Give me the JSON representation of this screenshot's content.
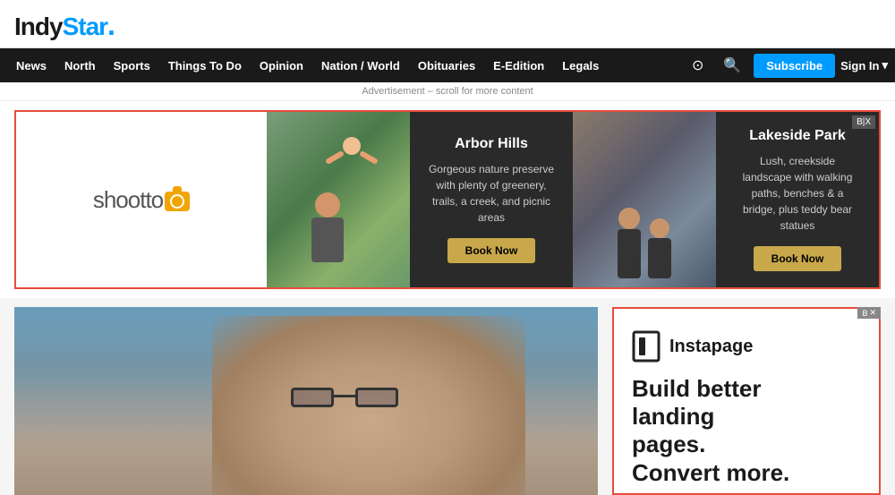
{
  "site": {
    "logo_text": "IndyStar",
    "logo_dot": "."
  },
  "nav": {
    "items": [
      {
        "label": "News",
        "id": "news"
      },
      {
        "label": "North",
        "id": "north"
      },
      {
        "label": "Sports",
        "id": "sports"
      },
      {
        "label": "Things To Do",
        "id": "things-to-do"
      },
      {
        "label": "Opinion",
        "id": "opinion"
      },
      {
        "label": "Nation / World",
        "id": "nation-world"
      },
      {
        "label": "Obituaries",
        "id": "obituaries"
      },
      {
        "label": "E-Edition",
        "id": "e-edition"
      },
      {
        "label": "Legals",
        "id": "legals"
      }
    ],
    "more_icon": "⊙",
    "search_icon": "🔍",
    "subscribe_label": "Subscribe",
    "signin_label": "Sign In",
    "signin_chevron": "▾"
  },
  "ad_notice": "Advertisement – scroll for more content",
  "main_ad": {
    "close_label": "B|X",
    "brand_name": "shootto",
    "left_section": {
      "title": "Arbor Hills",
      "description": "Gorgeous nature preserve with plenty of greenery, trails, a creek, and picnic areas",
      "cta": "Book Now"
    },
    "right_section": {
      "title": "Lakeside Park",
      "description": "Lush, creekside landscape with walking paths, benches & a bridge, plus teddy bear statues",
      "cta": "Book Now"
    }
  },
  "side_ad": {
    "brand_icon": "▐▌",
    "brand_name": "Instapage",
    "tagline_line1": "Build better",
    "tagline_line2": "landing",
    "tagline_line3": "pages.",
    "tagline_line4": "Convert more.",
    "close_label": "✕"
  },
  "colors": {
    "blue": "#009bff",
    "dark_nav": "#1a1a1a",
    "ad_border": "#e74c3c",
    "book_btn": "#c8a84b",
    "subscribe_btn": "#009bff"
  }
}
